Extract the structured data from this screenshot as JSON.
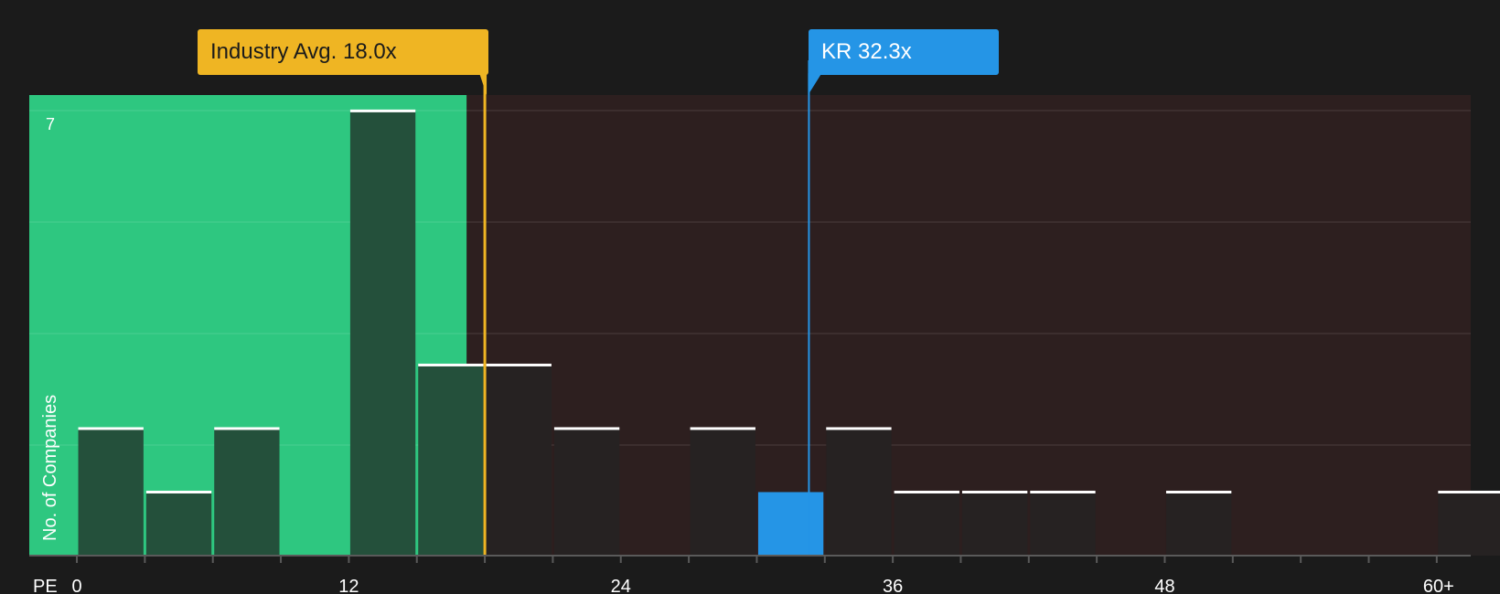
{
  "chart_data": {
    "type": "bar",
    "xlabel": "PE",
    "ylabel": "No. of Companies",
    "x_ticks": [
      "0",
      "12",
      "24",
      "36",
      "48",
      "60+"
    ],
    "y_ticks": [
      "7"
    ],
    "ylim": [
      0,
      7.25
    ],
    "xlim": [
      -2.1,
      61.5
    ],
    "bin_width": 3,
    "bins": [
      {
        "start": 0,
        "count": 2
      },
      {
        "start": 3,
        "count": 1
      },
      {
        "start": 6,
        "count": 2
      },
      {
        "start": 9,
        "count": 0
      },
      {
        "start": 12,
        "count": 7
      },
      {
        "start": 15,
        "count": 3
      },
      {
        "start": 18,
        "count": 3
      },
      {
        "start": 21,
        "count": 2
      },
      {
        "start": 24,
        "count": 0
      },
      {
        "start": 27,
        "count": 2
      },
      {
        "start": 30,
        "count": 1,
        "highlight": true
      },
      {
        "start": 33,
        "count": 2
      },
      {
        "start": 36,
        "count": 1
      },
      {
        "start": 39,
        "count": 1
      },
      {
        "start": 42,
        "count": 1
      },
      {
        "start": 45,
        "count": 0
      },
      {
        "start": 48,
        "count": 1
      },
      {
        "start": 51,
        "count": 0
      },
      {
        "start": 54,
        "count": 0
      },
      {
        "start": 57,
        "count": 0
      },
      {
        "start": 60,
        "count": 1
      }
    ],
    "industry_avg": {
      "label": "Industry Avg. 18.0x",
      "value": 18.0
    },
    "company": {
      "label": "KR 32.3x",
      "value": 32.3
    },
    "fair_zone_end": 17.2,
    "grid": true,
    "colors": {
      "background": "#1b1b1b",
      "fair_zone": "#2ec780",
      "expensive_zone": "#2d1f1f",
      "bar_fair": "#24503b",
      "bar_expensive": "#262222",
      "highlight": "#2595e6",
      "industry": "#efb523",
      "bar_cap": "#ffffff"
    }
  }
}
